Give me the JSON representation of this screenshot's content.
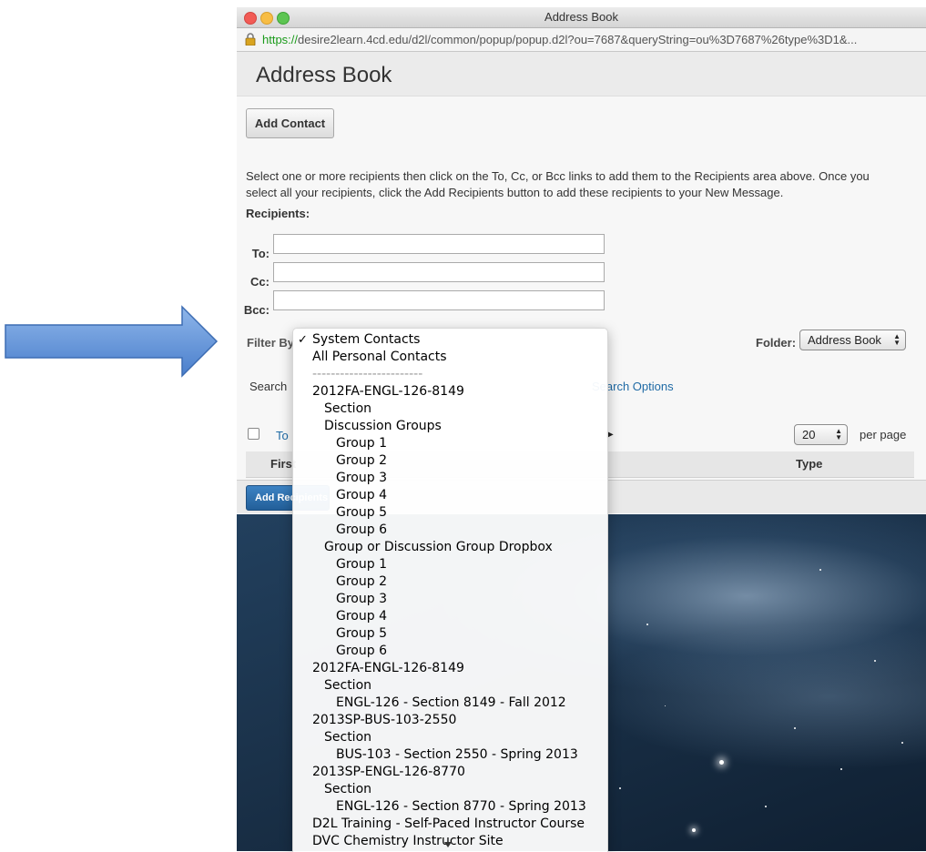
{
  "window": {
    "title": "Address Book",
    "url_scheme": "https://",
    "url_host": "desire2learn.4cd.edu",
    "url_path": "/d2l/common/popup/popup.d2l?ou=7687&queryString=ou%3D7687%26type%3D1&..."
  },
  "page": {
    "title": "Address Book",
    "add_contact_label": "Add Contact",
    "instructions": "Select one or more recipients then click on the To, Cc, or Bcc links to add them to the Recipients area above. Once you select all your recipients, click the Add Recipients button to add these recipients to your New Message.",
    "recipients_label": "Recipients:",
    "to_label": "To:",
    "cc_label": "Cc:",
    "bcc_label": "Bcc:",
    "to_value": "",
    "cc_value": "",
    "bcc_value": "",
    "filter_label": "Filter By",
    "folder_label": "Folder:",
    "folder_value": "Address Book",
    "search_label": "Search",
    "search_options_label": "Search Options",
    "to_link_label": "To",
    "per_page_value": "20",
    "per_page_label": "per page",
    "col_first": "First",
    "col_type": "Type",
    "add_recipients_label": "Add Recipients"
  },
  "dropdown": {
    "selected": "System Contacts",
    "options": [
      {
        "label": "System Contacts",
        "level": 0,
        "checked": true
      },
      {
        "label": "All Personal Contacts",
        "level": 0
      },
      {
        "label": "------------------------",
        "level": 0,
        "separator": true
      },
      {
        "label": "2012FA-ENGL-126-8149",
        "level": 0
      },
      {
        "label": "Section",
        "level": 1
      },
      {
        "label": "Discussion Groups",
        "level": 1
      },
      {
        "label": "Group 1",
        "level": 2
      },
      {
        "label": "Group 2",
        "level": 2
      },
      {
        "label": "Group 3",
        "level": 2
      },
      {
        "label": "Group 4",
        "level": 2
      },
      {
        "label": "Group 5",
        "level": 2
      },
      {
        "label": "Group 6",
        "level": 2
      },
      {
        "label": "Group or Discussion Group Dropbox",
        "level": 1
      },
      {
        "label": "Group 1",
        "level": 2
      },
      {
        "label": "Group 2",
        "level": 2
      },
      {
        "label": "Group 3",
        "level": 2
      },
      {
        "label": "Group 4",
        "level": 2
      },
      {
        "label": "Group 5",
        "level": 2
      },
      {
        "label": "Group 6",
        "level": 2
      },
      {
        "label": "2012FA-ENGL-126-8149",
        "level": 0
      },
      {
        "label": "Section",
        "level": 1
      },
      {
        "label": "ENGL-126 - Section 8149 - Fall 2012",
        "level": 2
      },
      {
        "label": "2013SP-BUS-103-2550",
        "level": 0
      },
      {
        "label": "Section",
        "level": 1
      },
      {
        "label": "BUS-103 - Section 2550 - Spring 2013",
        "level": 2
      },
      {
        "label": "2013SP-ENGL-126-8770",
        "level": 0
      },
      {
        "label": "Section",
        "level": 1
      },
      {
        "label": "ENGL-126 - Section 8770 - Spring 2013",
        "level": 2
      },
      {
        "label": "D2L Training - Self-Paced Instructor Course",
        "level": 0
      },
      {
        "label": "DVC Chemistry Instructor Site",
        "level": 0
      }
    ]
  },
  "colors": {
    "arrow": "#5b8fd6",
    "link": "#1f6aa5",
    "primary_button": "#2f6fae"
  },
  "icons": [
    "arrow-pointer-icon",
    "lock-icon",
    "checkmark-icon",
    "updown-chevron-icon",
    "play-next-icon",
    "scroll-down-icon"
  ]
}
